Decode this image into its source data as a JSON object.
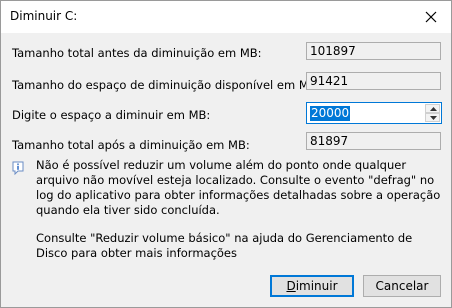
{
  "window": {
    "title": "Diminuir C:"
  },
  "fields": {
    "total_before_label": "Tamanho total antes da diminuição em MB:",
    "total_before_value": "101897",
    "available_label": "Tamanho do espaço de diminuição disponível em MB:",
    "available_value": "91421",
    "shrink_amount_label": "Digite o espaço a diminuir em MB:",
    "shrink_amount_value": "20000",
    "total_after_label": "Tamanho total após a diminuição em MB:",
    "total_after_value": "81897"
  },
  "info": {
    "message": "Não é possível reduzir um volume além do ponto onde qualquer arquivo não movível esteja localizado. Consulte o evento \"defrag\" no log do aplicativo para obter informações detalhadas sobre a operação quando ela tiver sido concluída.",
    "help": "Consulte \"Reduzir volume básico\" na ajuda do Gerenciamento de Disco para obter mais informações"
  },
  "buttons": {
    "shrink_mnemonic": "D",
    "shrink_rest": "iminuir",
    "cancel_label": "Cancelar"
  },
  "colors": {
    "accent": "#0078d7",
    "dialog_bg": "#f0f0f0",
    "titlebar_bg": "#ffffff"
  }
}
